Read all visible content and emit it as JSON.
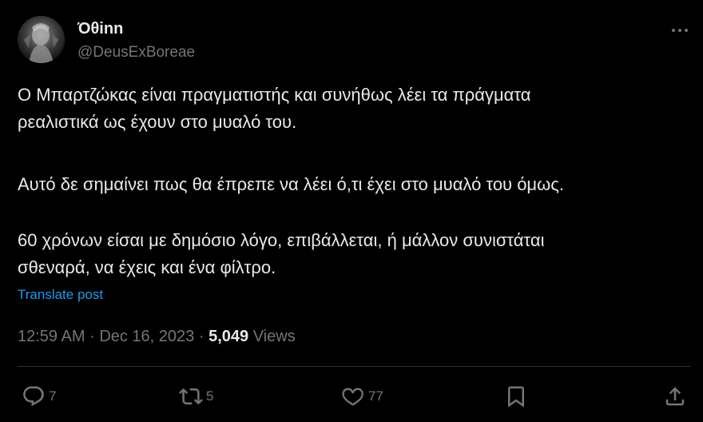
{
  "author": {
    "display_name": "Όθinn",
    "handle": "@DeusExBoreae"
  },
  "post": {
    "paragraph_1": "Ο Μπαρτζώκας είναι πραγματιστής και συνήθως λέει τα πράγματα\nρεαλιστικά ως έχουν στο μυαλό του.",
    "paragraph_2": "Αυτό δε σημαίνει πως θα έπρεπε να λέει ό,τι έχει στο μυαλό του όμως.",
    "paragraph_3": "60 χρόνων είσαι με δημόσιο λόγο, επιβάλλεται, ή μάλλον συνιστάται\nσθεναρά, να έχεις και ένα φίλτρο.",
    "translate_label": "Translate post"
  },
  "meta": {
    "time": "12:59 AM",
    "separator": "·",
    "date": "Dec 16, 2023",
    "views_count": "5,049",
    "views_label": "Views"
  },
  "actions": {
    "reply_count": "7",
    "repost_count": "5",
    "like_count": "77"
  },
  "colors": {
    "background": "#000000",
    "text": "#e7e9ea",
    "secondary": "#71767b",
    "link": "#1d9bf0"
  },
  "icons": {
    "more": "more-horizontal-icon",
    "reply": "reply-icon",
    "repost": "repost-icon",
    "like": "heart-icon",
    "bookmark": "bookmark-icon",
    "share": "share-icon"
  }
}
